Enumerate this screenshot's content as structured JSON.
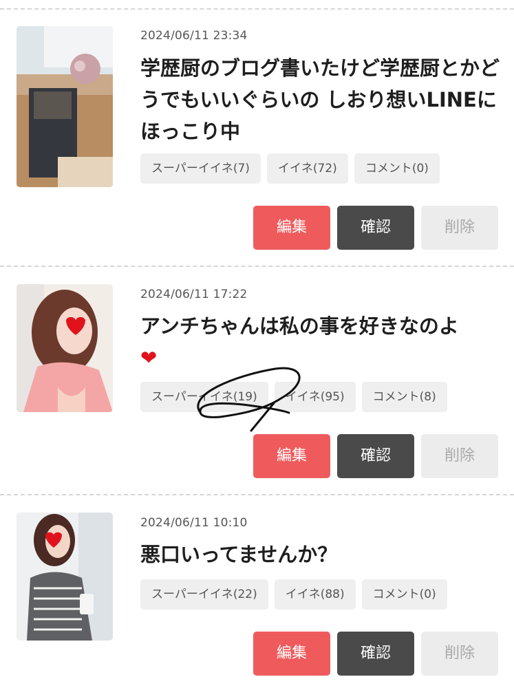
{
  "posts": [
    {
      "date": "2024/06/11 23:34",
      "title": "学歴厨のブログ書いたけど学歴厨とかどうでもいいぐらいの しおり想いLINEにほっこり中",
      "title_emoji": "",
      "tags": {
        "super_like": "スーパーイイネ(7)",
        "like": "イイネ(72)",
        "comment": "コメント(0)"
      },
      "buttons": {
        "edit": "編集",
        "confirm": "確認",
        "delete": "削除"
      }
    },
    {
      "date": "2024/06/11 17:22",
      "title": "アンチちゃんは私の事を好きなのよ",
      "title_emoji": "❤",
      "tags": {
        "super_like": "スーパーイイネ(19)",
        "like": "イイネ(95)",
        "comment": "コメント(8)"
      },
      "buttons": {
        "edit": "編集",
        "confirm": "確認",
        "delete": "削除"
      }
    },
    {
      "date": "2024/06/11 10:10",
      "title": "悪口いってませんか？",
      "title_emoji": "",
      "tags": {
        "super_like": "スーパーイイネ(22)",
        "like": "イイネ(88)",
        "comment": "コメント(0)"
      },
      "buttons": {
        "edit": "編集",
        "confirm": "確認",
        "delete": "削除"
      }
    }
  ],
  "colors": {
    "edit": "#ef5b5d",
    "confirm": "#4a4a4a",
    "delete": "#ececec",
    "tag": "#efefef",
    "heart": "#e0131c"
  }
}
